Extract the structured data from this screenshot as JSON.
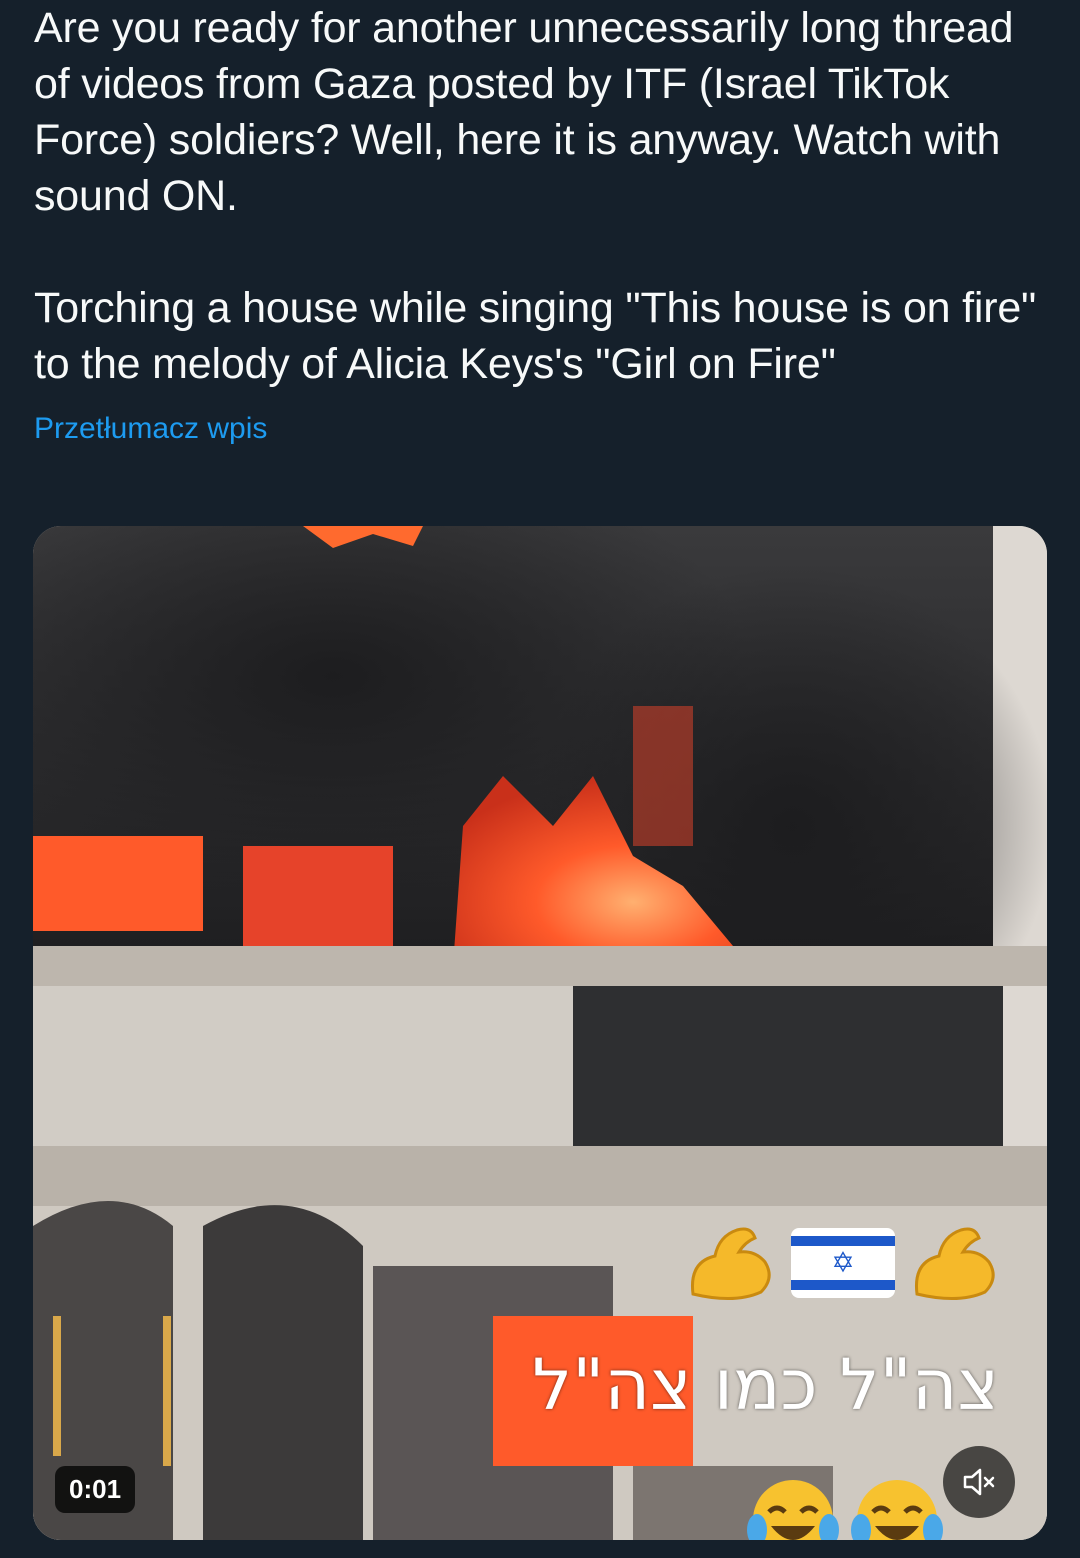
{
  "post": {
    "paragraph1": "Are you ready for another unnecessarily long thread of videos from Gaza posted by ITF (Israel TikTok Force) soldiers? Well, here it is anyway. Watch with sound ON.",
    "paragraph2": "Torching a house while singing \"This house is on fire\" to the melody of Alicia Keys's \"Girl on Fire\"",
    "translate_label": "Przetłumacz wpis"
  },
  "video": {
    "overlay_caption": "צה\"ל כמו צה\"ל",
    "timestamp": "0:01",
    "muted": true,
    "emojis": [
      "flexed-biceps-icon",
      "israel-flag-icon",
      "flexed-biceps-icon",
      "face-with-tears-of-joy-icon",
      "face-with-tears-of-joy-icon"
    ]
  },
  "colors": {
    "background": "#15202b",
    "text": "#f7f9f9",
    "link": "#1d9bf0"
  }
}
